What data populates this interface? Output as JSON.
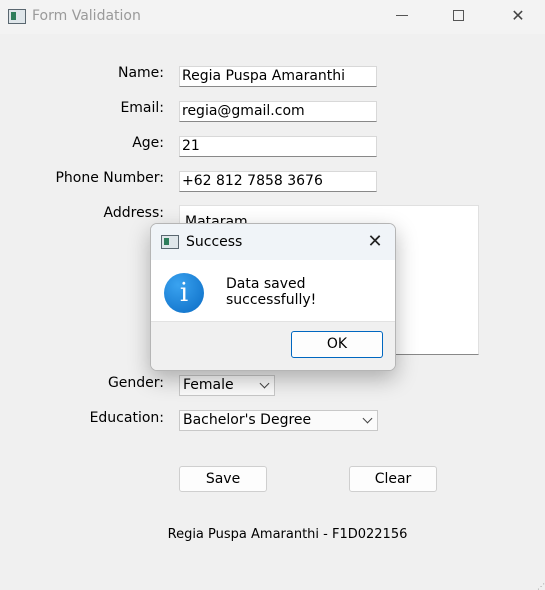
{
  "window": {
    "title": "Form Validation"
  },
  "form": {
    "name_label": "Name:",
    "name_value": "Regia Puspa Amaranthi",
    "email_label": "Email:",
    "email_value": "regia@gmail.com",
    "age_label": "Age:",
    "age_value": "21",
    "phone_label": "Phone Number:",
    "phone_value": "+62 812 7858 3676",
    "address_label": "Address:",
    "address_value": "Mataram",
    "gender_label": "Gender:",
    "gender_value": "Female",
    "education_label": "Education:",
    "education_value": "Bachelor's Degree",
    "save_label": "Save",
    "clear_label": "Clear"
  },
  "footer": {
    "text": "Regia Puspa Amaranthi - F1D022156"
  },
  "dialog": {
    "title": "Success",
    "message": "Data saved successfully!",
    "ok_label": "OK",
    "icon": "info-icon"
  }
}
